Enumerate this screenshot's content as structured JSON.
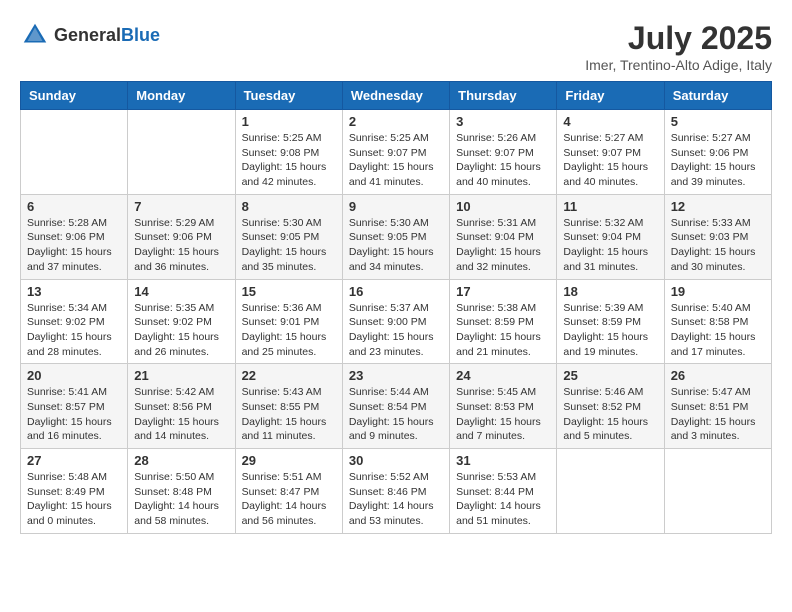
{
  "header": {
    "logo_general": "General",
    "logo_blue": "Blue",
    "month_title": "July 2025",
    "location": "Imer, Trentino-Alto Adige, Italy"
  },
  "days_of_week": [
    "Sunday",
    "Monday",
    "Tuesday",
    "Wednesday",
    "Thursday",
    "Friday",
    "Saturday"
  ],
  "weeks": [
    [
      {
        "day": "",
        "info": ""
      },
      {
        "day": "",
        "info": ""
      },
      {
        "day": "1",
        "info": "Sunrise: 5:25 AM\nSunset: 9:08 PM\nDaylight: 15 hours and 42 minutes."
      },
      {
        "day": "2",
        "info": "Sunrise: 5:25 AM\nSunset: 9:07 PM\nDaylight: 15 hours and 41 minutes."
      },
      {
        "day": "3",
        "info": "Sunrise: 5:26 AM\nSunset: 9:07 PM\nDaylight: 15 hours and 40 minutes."
      },
      {
        "day": "4",
        "info": "Sunrise: 5:27 AM\nSunset: 9:07 PM\nDaylight: 15 hours and 40 minutes."
      },
      {
        "day": "5",
        "info": "Sunrise: 5:27 AM\nSunset: 9:06 PM\nDaylight: 15 hours and 39 minutes."
      }
    ],
    [
      {
        "day": "6",
        "info": "Sunrise: 5:28 AM\nSunset: 9:06 PM\nDaylight: 15 hours and 37 minutes."
      },
      {
        "day": "7",
        "info": "Sunrise: 5:29 AM\nSunset: 9:06 PM\nDaylight: 15 hours and 36 minutes."
      },
      {
        "day": "8",
        "info": "Sunrise: 5:30 AM\nSunset: 9:05 PM\nDaylight: 15 hours and 35 minutes."
      },
      {
        "day": "9",
        "info": "Sunrise: 5:30 AM\nSunset: 9:05 PM\nDaylight: 15 hours and 34 minutes."
      },
      {
        "day": "10",
        "info": "Sunrise: 5:31 AM\nSunset: 9:04 PM\nDaylight: 15 hours and 32 minutes."
      },
      {
        "day": "11",
        "info": "Sunrise: 5:32 AM\nSunset: 9:04 PM\nDaylight: 15 hours and 31 minutes."
      },
      {
        "day": "12",
        "info": "Sunrise: 5:33 AM\nSunset: 9:03 PM\nDaylight: 15 hours and 30 minutes."
      }
    ],
    [
      {
        "day": "13",
        "info": "Sunrise: 5:34 AM\nSunset: 9:02 PM\nDaylight: 15 hours and 28 minutes."
      },
      {
        "day": "14",
        "info": "Sunrise: 5:35 AM\nSunset: 9:02 PM\nDaylight: 15 hours and 26 minutes."
      },
      {
        "day": "15",
        "info": "Sunrise: 5:36 AM\nSunset: 9:01 PM\nDaylight: 15 hours and 25 minutes."
      },
      {
        "day": "16",
        "info": "Sunrise: 5:37 AM\nSunset: 9:00 PM\nDaylight: 15 hours and 23 minutes."
      },
      {
        "day": "17",
        "info": "Sunrise: 5:38 AM\nSunset: 8:59 PM\nDaylight: 15 hours and 21 minutes."
      },
      {
        "day": "18",
        "info": "Sunrise: 5:39 AM\nSunset: 8:59 PM\nDaylight: 15 hours and 19 minutes."
      },
      {
        "day": "19",
        "info": "Sunrise: 5:40 AM\nSunset: 8:58 PM\nDaylight: 15 hours and 17 minutes."
      }
    ],
    [
      {
        "day": "20",
        "info": "Sunrise: 5:41 AM\nSunset: 8:57 PM\nDaylight: 15 hours and 16 minutes."
      },
      {
        "day": "21",
        "info": "Sunrise: 5:42 AM\nSunset: 8:56 PM\nDaylight: 15 hours and 14 minutes."
      },
      {
        "day": "22",
        "info": "Sunrise: 5:43 AM\nSunset: 8:55 PM\nDaylight: 15 hours and 11 minutes."
      },
      {
        "day": "23",
        "info": "Sunrise: 5:44 AM\nSunset: 8:54 PM\nDaylight: 15 hours and 9 minutes."
      },
      {
        "day": "24",
        "info": "Sunrise: 5:45 AM\nSunset: 8:53 PM\nDaylight: 15 hours and 7 minutes."
      },
      {
        "day": "25",
        "info": "Sunrise: 5:46 AM\nSunset: 8:52 PM\nDaylight: 15 hours and 5 minutes."
      },
      {
        "day": "26",
        "info": "Sunrise: 5:47 AM\nSunset: 8:51 PM\nDaylight: 15 hours and 3 minutes."
      }
    ],
    [
      {
        "day": "27",
        "info": "Sunrise: 5:48 AM\nSunset: 8:49 PM\nDaylight: 15 hours and 0 minutes."
      },
      {
        "day": "28",
        "info": "Sunrise: 5:50 AM\nSunset: 8:48 PM\nDaylight: 14 hours and 58 minutes."
      },
      {
        "day": "29",
        "info": "Sunrise: 5:51 AM\nSunset: 8:47 PM\nDaylight: 14 hours and 56 minutes."
      },
      {
        "day": "30",
        "info": "Sunrise: 5:52 AM\nSunset: 8:46 PM\nDaylight: 14 hours and 53 minutes."
      },
      {
        "day": "31",
        "info": "Sunrise: 5:53 AM\nSunset: 8:44 PM\nDaylight: 14 hours and 51 minutes."
      },
      {
        "day": "",
        "info": ""
      },
      {
        "day": "",
        "info": ""
      }
    ]
  ]
}
